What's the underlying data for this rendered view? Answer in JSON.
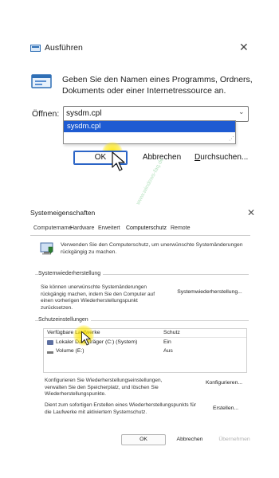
{
  "run": {
    "title": "Ausführen",
    "close": "✕",
    "description": "Geben Sie den Namen eines Programms, Ordners, Dokuments oder einer Internetressource an.",
    "open_label": "Öffnen:",
    "open_value": "sysdm.cpl",
    "dropdown_items": [
      "sysdm.cpl"
    ],
    "ok": "OK",
    "cancel": "Abbrechen",
    "browse_prefix": "D",
    "browse_rest": "urchsuchen..."
  },
  "sys": {
    "title": "Systemeigenschaften",
    "close": "✕",
    "tabs": [
      "Computername",
      "Hardware",
      "Erweitert",
      "Computerschutz",
      "Remote"
    ],
    "description": "Verwenden Sie den Computerschutz, um unerwünschte Systemänderungen rückgängig zu machen.",
    "restore_group": "Systemwiederherstellung",
    "restore_text": "Sie können unerwünschte Systemänderungen rückgängig machen, indem Sie den Computer auf einen vorherigen Wiederherstellungspunkt zurücksetzen.",
    "restore_button": "Systemwiederherstellung...",
    "protection_group": "Schutzeinstellungen",
    "columns": [
      "Verfügbare Laufwerke",
      "Schutz"
    ],
    "drives": [
      {
        "name": "Lokaler Datenträger (C:) (System)",
        "protection": "Ein"
      },
      {
        "name": "Volume (E:)",
        "protection": "Aus"
      }
    ],
    "configure_text": "Konfigurieren Sie Wiederherstellungseinstellungen, verwalten Sie den Speicherplatz, und löschen Sie Wiederherstellungspunkte.",
    "configure_button": "Konfigurieren...",
    "create_text": "Dient zum sofortigen Erstellen eines Wiederherstellungspunkts für die Laufwerke mit aktiviertem Systemschutz.",
    "create_button": "Erstellen...",
    "ok": "OK",
    "cancel": "Abbrechen",
    "apply": "Übernehmen"
  },
  "watermark": "www.windows-faq.de",
  "colors": {
    "accent": "#1e5bd2",
    "highlight": "#ffe600"
  }
}
